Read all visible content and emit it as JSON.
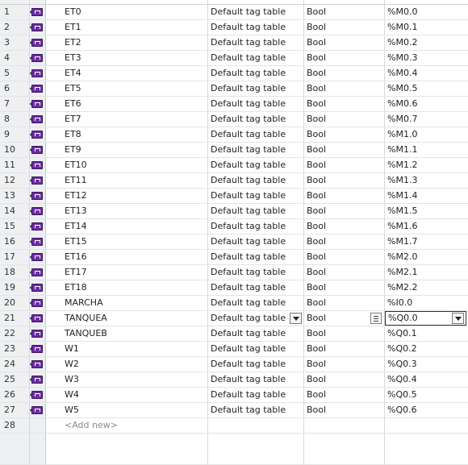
{
  "tag_table": {
    "add_new_label": "<Add new>",
    "empty_row_number": "28",
    "rows": [
      {
        "num": "1",
        "name": "ET0",
        "table": "Default tag table",
        "type": "Bool",
        "address": "%M0.0"
      },
      {
        "num": "2",
        "name": "ET1",
        "table": "Default tag table",
        "type": "Bool",
        "address": "%M0.1"
      },
      {
        "num": "3",
        "name": "ET2",
        "table": "Default tag table",
        "type": "Bool",
        "address": "%M0.2"
      },
      {
        "num": "4",
        "name": "ET3",
        "table": "Default tag table",
        "type": "Bool",
        "address": "%M0.3"
      },
      {
        "num": "5",
        "name": "ET4",
        "table": "Default tag table",
        "type": "Bool",
        "address": "%M0.4"
      },
      {
        "num": "6",
        "name": "ET5",
        "table": "Default tag table",
        "type": "Bool",
        "address": "%M0.5"
      },
      {
        "num": "7",
        "name": "ET6",
        "table": "Default tag table",
        "type": "Bool",
        "address": "%M0.6"
      },
      {
        "num": "8",
        "name": "ET7",
        "table": "Default tag table",
        "type": "Bool",
        "address": "%M0.7"
      },
      {
        "num": "9",
        "name": "ET8",
        "table": "Default tag table",
        "type": "Bool",
        "address": "%M1.0"
      },
      {
        "num": "10",
        "name": "ET9",
        "table": "Default tag table",
        "type": "Bool",
        "address": "%M1.1"
      },
      {
        "num": "11",
        "name": "ET10",
        "table": "Default tag table",
        "type": "Bool",
        "address": "%M1.2"
      },
      {
        "num": "12",
        "name": "ET11",
        "table": "Default tag table",
        "type": "Bool",
        "address": "%M1.3"
      },
      {
        "num": "13",
        "name": "ET12",
        "table": "Default tag table",
        "type": "Bool",
        "address": "%M1.4"
      },
      {
        "num": "14",
        "name": "ET13",
        "table": "Default tag table",
        "type": "Bool",
        "address": "%M1.5"
      },
      {
        "num": "15",
        "name": "ET14",
        "table": "Default tag table",
        "type": "Bool",
        "address": "%M1.6"
      },
      {
        "num": "16",
        "name": "ET15",
        "table": "Default tag table",
        "type": "Bool",
        "address": "%M1.7"
      },
      {
        "num": "17",
        "name": "ET16",
        "table": "Default tag table",
        "type": "Bool",
        "address": "%M2.0"
      },
      {
        "num": "18",
        "name": "ET17",
        "table": "Default tag table",
        "type": "Bool",
        "address": "%M2.1"
      },
      {
        "num": "19",
        "name": "ET18",
        "table": "Default tag table",
        "type": "Bool",
        "address": "%M2.2"
      },
      {
        "num": "20",
        "name": "MARCHA",
        "table": "Default tag table",
        "type": "Bool",
        "address": "%I0.0"
      },
      {
        "num": "21",
        "name": "TANQUEA",
        "table": "Default tag table",
        "type": "Bool",
        "address": "%Q0.0",
        "editing": true
      },
      {
        "num": "22",
        "name": "TANQUEB",
        "table": "Default tag table",
        "type": "Bool",
        "address": "%Q0.1"
      },
      {
        "num": "23",
        "name": "W1",
        "table": "Default tag table",
        "type": "Bool",
        "address": "%Q0.2"
      },
      {
        "num": "24",
        "name": "W2",
        "table": "Default tag table",
        "type": "Bool",
        "address": "%Q0.3"
      },
      {
        "num": "25",
        "name": "W3",
        "table": "Default tag table",
        "type": "Bool",
        "address": "%Q0.4"
      },
      {
        "num": "26",
        "name": "W4",
        "table": "Default tag table",
        "type": "Bool",
        "address": "%Q0.5"
      },
      {
        "num": "27",
        "name": "W5",
        "table": "Default tag table",
        "type": "Bool",
        "address": "%Q0.6"
      }
    ]
  },
  "icons": {
    "tag": "plc-tag-icon",
    "dropdown": "chevron-down-icon",
    "list": "list-icon"
  },
  "colors": {
    "tag_icon": "#6a2ea0",
    "row_header_bg": "#eef0f2",
    "grid_line": "#e4e4e4"
  }
}
